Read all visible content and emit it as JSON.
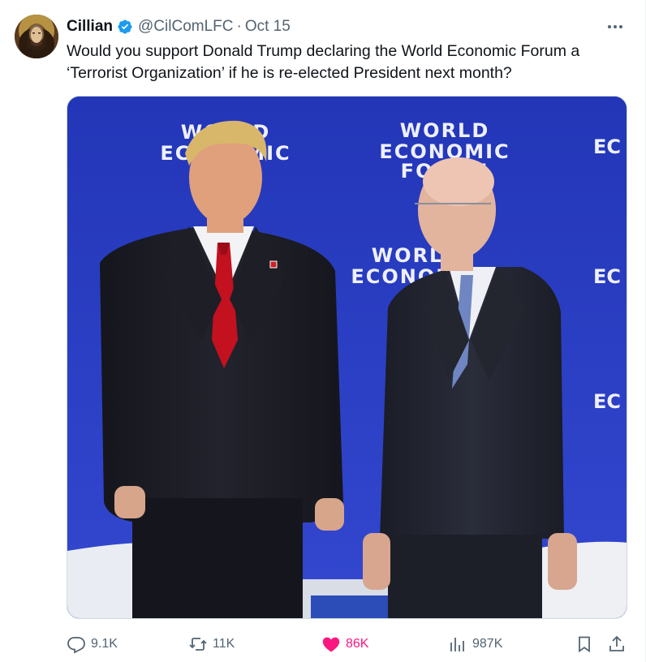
{
  "author": {
    "name": "Cillian",
    "handle": "@CilComLFC",
    "separator": "·",
    "date": "Oct 15",
    "verified": true
  },
  "tweet": {
    "text_line1": "Would you support Donald Trump declaring the World Economic Forum a",
    "text_line2": "‘Terrorist Organization’ if he is re-elected President next month?"
  },
  "media": {
    "backdrop_texts": [
      "WORLD",
      "ECONOMIC",
      "FORUM",
      "WORLD",
      "ECONOMIC",
      "EC"
    ]
  },
  "actions": {
    "replies": "9.1K",
    "reposts": "11K",
    "likes": "86K",
    "views": "987K"
  },
  "colors": {
    "accent_like": "#f91880",
    "verified_blue": "#1d9bf0",
    "secondary_text": "#536471",
    "backdrop_blue": "#2a3fc4"
  }
}
